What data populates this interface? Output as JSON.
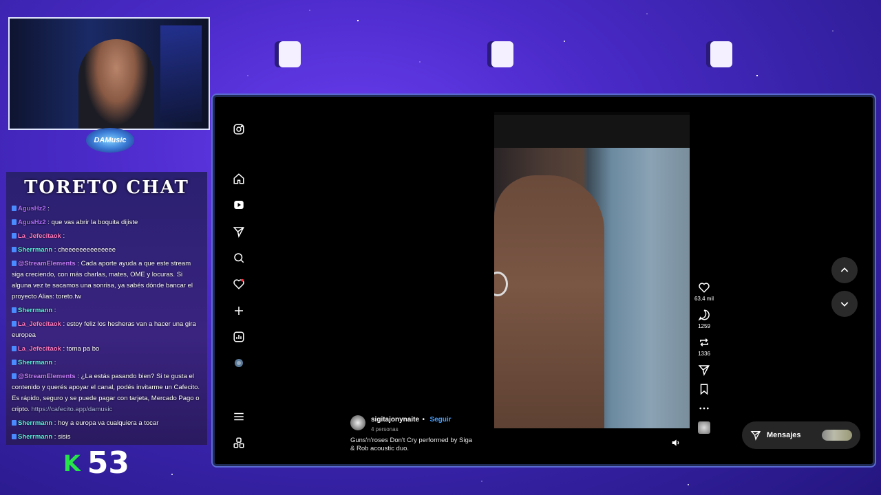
{
  "chat": {
    "title": "TORETO CHAT",
    "messages": [
      {
        "user": "AgusHz2",
        "text": ":",
        "color": "#b06cff"
      },
      {
        "user": "AgusHz2",
        "text": ": que vas abrir la boquita dijiste",
        "color": "#b06cff"
      },
      {
        "user": "La_Jefecitaok",
        "text": ":",
        "color": "#ff7ac0"
      },
      {
        "user": "Sherrmann",
        "text": ": cheeeeeeeeeeeeee",
        "color": "#5ef0e0"
      },
      {
        "user": "@StreamElements",
        "text": ": Cada aporte ayuda a que este stream siga creciendo, con más charlas, mates, OME y locuras. Si alguna vez te sacamos una sonrisa, ya sabés dónde bancar el proyecto Alias: toreto.tw",
        "color": "#c77dff"
      },
      {
        "user": "Sherrmann",
        "text": ":",
        "color": "#5ef0e0"
      },
      {
        "user": "La_Jefecitaok",
        "text": ": estoy feliz los hesheras van a hacer una gira europea",
        "color": "#ff7ac0"
      },
      {
        "user": "La_Jefecitaok",
        "text": ": toma pa bo",
        "color": "#ff7ac0"
      },
      {
        "user": "Sherrmann",
        "text": ":",
        "color": "#5ef0e0"
      },
      {
        "user": "@StreamElements",
        "text": ": ¿La estás pasando bien? Si te gusta el contenido y querés apoyar el canal, podés invitarme un Cafecito. Es rápido, seguro y se puede pagar con tarjeta, Mercado Pago o cripto.",
        "link": "https://cafecito.app/damusic",
        "color": "#c77dff"
      },
      {
        "user": "Sherrmann",
        "text": ": hoy a europa va cualquiera a tocar",
        "color": "#5ef0e0"
      },
      {
        "user": "Sherrmann",
        "text": ": sisis",
        "color": "#5ef0e0"
      }
    ]
  },
  "counter": {
    "prefix": "K",
    "value": "53"
  },
  "logo": {
    "text": "DAMusic"
  },
  "post": {
    "username": "sigitajonynaite",
    "separator": "•",
    "follow_label": "Seguir",
    "people": "4 personas",
    "caption": "Guns'n'roses Don't Cry performed by Siga & Rob acoustic duo.",
    "likes": "63,4 mil",
    "comments": "1259",
    "reposts": "1336"
  },
  "messages_button": {
    "label": "Mensajes"
  },
  "icons": {
    "nav": [
      "instagram-icon",
      "home-icon",
      "reels-icon",
      "send-icon",
      "search-icon",
      "heart-icon",
      "create-icon",
      "insights-icon",
      "profile-avatar",
      "menu-icon",
      "threads-icon"
    ],
    "actions": [
      "heart-icon",
      "comment-icon",
      "repost-icon",
      "send-icon",
      "bookmark-icon",
      "more-icon"
    ]
  },
  "colors": {
    "accent_blue": "#4aa0ff",
    "chat_green": "#27e34a",
    "bg_purple": "#4a2ac8"
  }
}
